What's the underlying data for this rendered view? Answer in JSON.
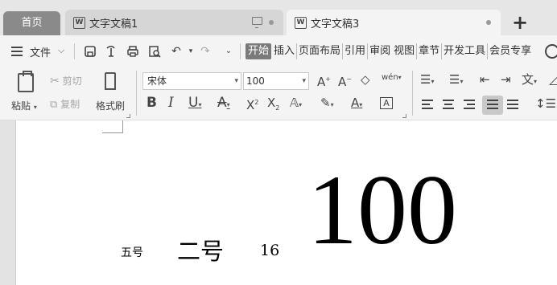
{
  "tabs": {
    "home": "首页",
    "docs": [
      {
        "label": "文字文稿1",
        "icon": "W"
      },
      {
        "label": "文字文稿3",
        "icon": "W"
      }
    ],
    "add": "+"
  },
  "menu": {
    "file": "文件",
    "ribbon_tabs": [
      "开始",
      "插入",
      "页面布局",
      "引用",
      "审阅",
      "视图",
      "章节",
      "开发工具",
      "会员专享"
    ]
  },
  "ribbon": {
    "paste": "粘贴",
    "cut": "剪切",
    "copy": "复制",
    "format_painter": "格式刷",
    "font_name": "宋体",
    "font_size": "100",
    "phonetic": "wén"
  },
  "document": {
    "samples": [
      "五号",
      "二号",
      "16",
      "100"
    ]
  }
}
